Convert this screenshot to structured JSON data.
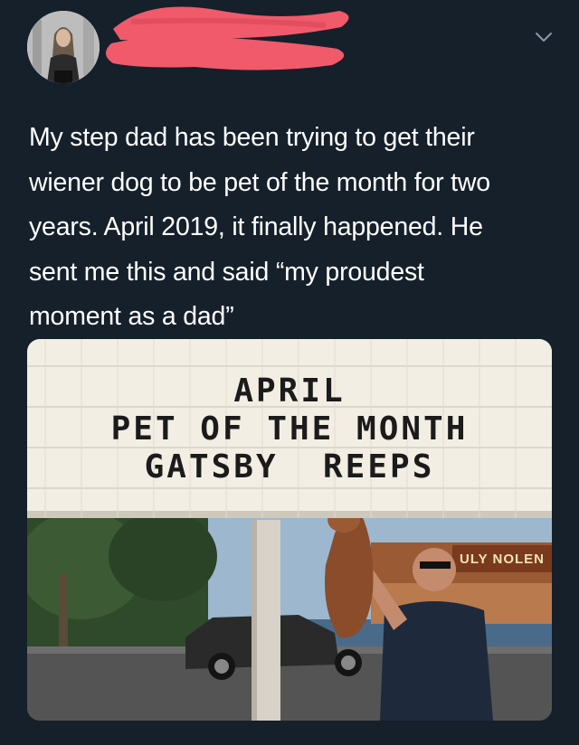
{
  "tweet": {
    "text_lines": [
      "My step dad has been trying to get their",
      "wiener dog to be pet of the month for two",
      "years. April 2019, it finally happened. He",
      "sent me this and said “my proudest",
      "moment as a dad”"
    ],
    "menu_icon": "chevron-down-icon"
  },
  "photo": {
    "sign_lines": [
      "APRIL",
      "PET OF THE MONTH",
      "GATSBY  REEPS"
    ],
    "storefront_sign": "ULY NOLEN"
  },
  "colors": {
    "background": "#15202b",
    "redaction": "#f05a6a",
    "text": "#ffffff"
  }
}
